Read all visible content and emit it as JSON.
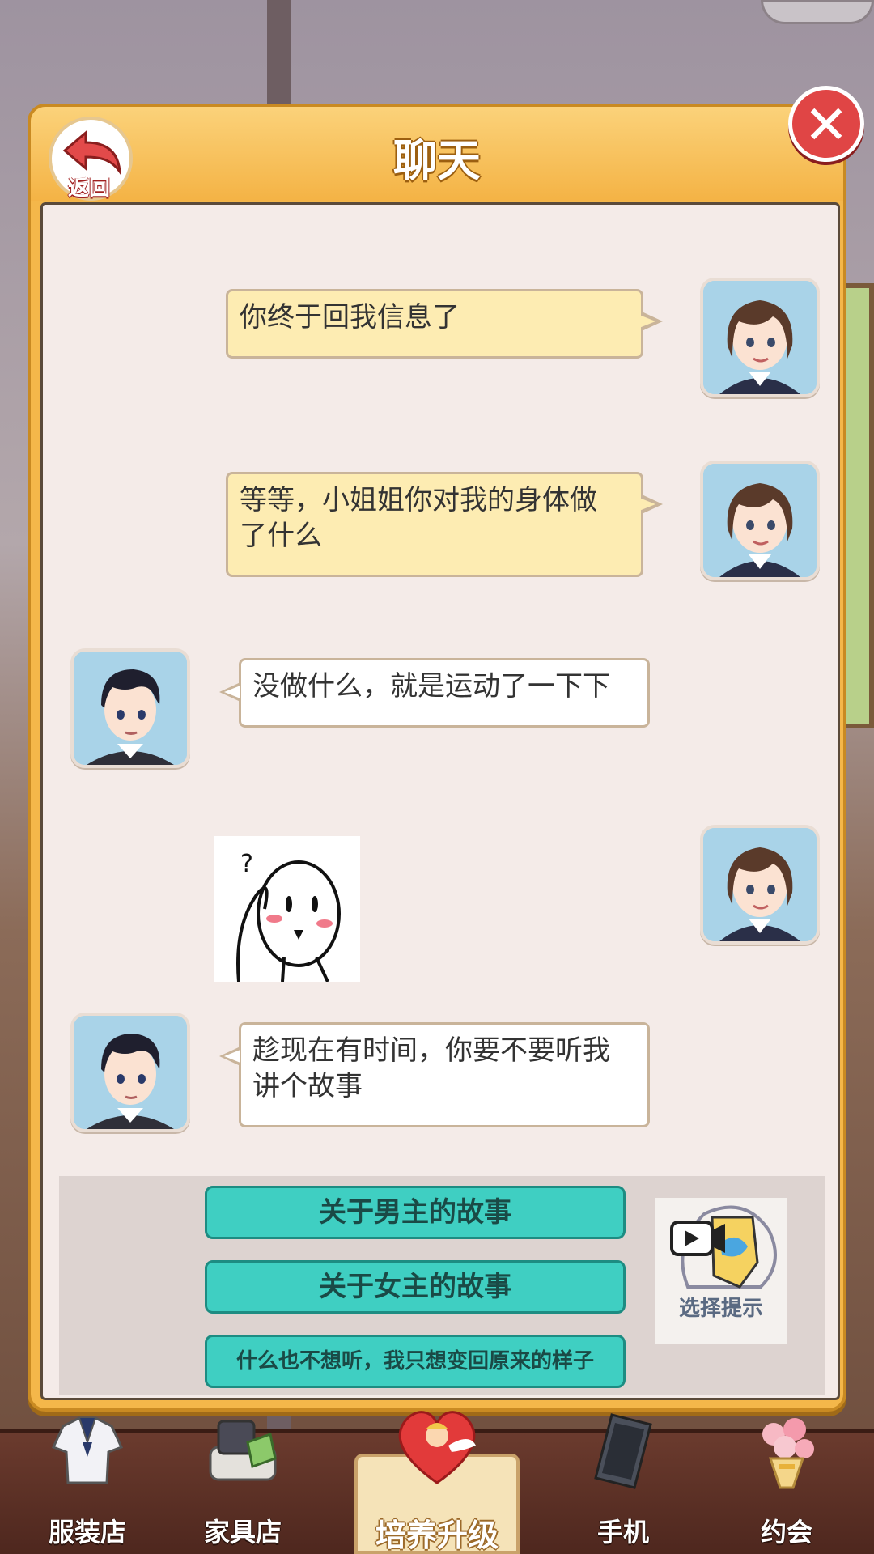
{
  "dialog": {
    "title": "聊天",
    "back_label": "返回",
    "close_label": "✕"
  },
  "messages": [
    {
      "side": "right",
      "speaker": "girl",
      "text": "你终于回我信息了"
    },
    {
      "side": "right",
      "speaker": "girl",
      "text_line1": "等等，小姐姐你对我的身体做",
      "text_line2": "了什么"
    },
    {
      "side": "left",
      "speaker": "boy",
      "text": "没做什么，就是运动了一下下"
    },
    {
      "side": "right",
      "speaker": "girl",
      "sticker": "confused-blush-sticker"
    },
    {
      "side": "left",
      "speaker": "boy",
      "text_line1": "趁现在有时间，你要不要听我",
      "text_line2": "讲个故事"
    }
  ],
  "options": [
    {
      "label": "关于男主的故事"
    },
    {
      "label": "关于女主的故事"
    },
    {
      "label": "什么也不想听，我只想变回原来的样子"
    }
  ],
  "hint": {
    "label": "选择提示",
    "icon": "video-hint-icon"
  },
  "bottom_nav": [
    {
      "label": "服装店",
      "icon": "sailor-uniform-icon"
    },
    {
      "label": "家具店",
      "icon": "furniture-icon"
    },
    {
      "label": "培养升级",
      "icon": "cupid-heart-icon"
    },
    {
      "label": "手机",
      "icon": "phone-icon"
    },
    {
      "label": "约会",
      "icon": "flower-bouquet-icon"
    }
  ],
  "colors": {
    "header": "#f4b74a",
    "chat_bg": "#f4ebe8",
    "right_bubble": "#fdecb2",
    "option_button": "#3fcfc2",
    "close_button": "#e04545"
  }
}
